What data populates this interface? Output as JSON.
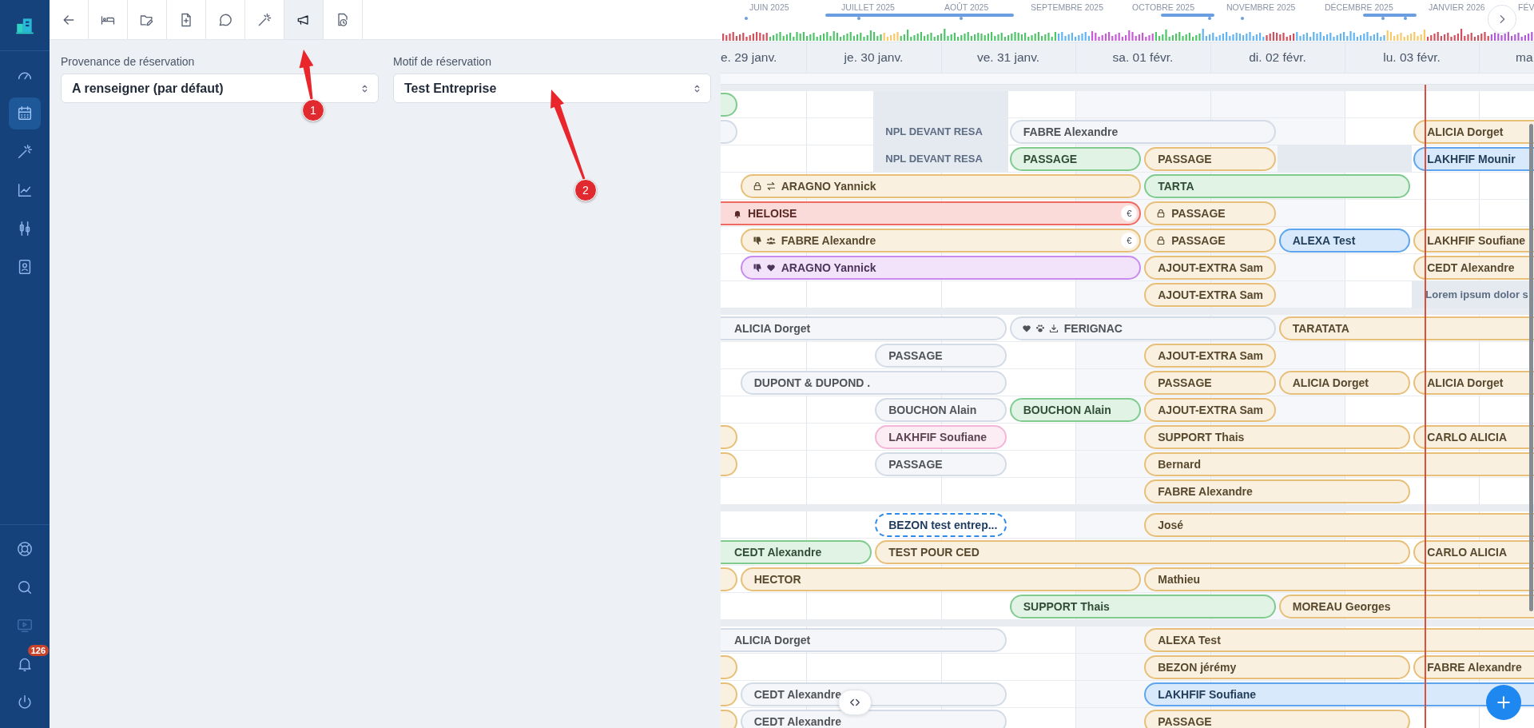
{
  "sidebar": {
    "nav": [
      {
        "kind": "gauge",
        "selected": false
      },
      {
        "kind": "calendar",
        "selected": true
      },
      {
        "kind": "wand",
        "selected": false
      },
      {
        "kind": "chart",
        "selected": false
      },
      {
        "kind": "candles",
        "selected": false
      },
      {
        "kind": "contact",
        "selected": false
      }
    ],
    "bottom": [
      {
        "kind": "lifebuoy",
        "disabled": false
      },
      {
        "kind": "search",
        "disabled": false
      },
      {
        "kind": "tv",
        "disabled": true
      },
      {
        "kind": "bell",
        "disabled": false,
        "badge": "126"
      },
      {
        "kind": "power",
        "disabled": false
      }
    ]
  },
  "toolbar": {
    "tabs": [
      {
        "kind": "back",
        "selected": false
      },
      {
        "kind": "bed",
        "selected": false
      },
      {
        "kind": "folder",
        "selected": false
      },
      {
        "kind": "file-plus",
        "selected": false
      },
      {
        "kind": "chat",
        "selected": false
      },
      {
        "kind": "wand",
        "selected": false
      },
      {
        "kind": "megaphone",
        "selected": true
      },
      {
        "kind": "file-clock",
        "selected": false
      }
    ]
  },
  "panel": {
    "fields": [
      {
        "label": "Provenance de réservation",
        "value": "A renseigner (par défaut)"
      },
      {
        "label": "Motif de réservation",
        "value": "Test Entreprise"
      }
    ]
  },
  "annotations": [
    {
      "label": "1"
    },
    {
      "label": "2"
    }
  ],
  "calendar": {
    "months": [
      "JUIN 2025",
      "JUILLET 2025",
      "AOÛT 2025",
      "SEPTEMBRE 2025",
      "OCTOBRE 2025",
      "NOVEMBRE 2025",
      "DÉCEMBRE 2025",
      "JANVIER 2026",
      "FÉV"
    ],
    "days": [
      "e. 29 janv.",
      "je. 30 janv.",
      "ve. 31 janv.",
      "sa. 01 févr.",
      "di. 02 févr.",
      "lu. 03 févr.",
      "ma"
    ],
    "groups": [
      {
        "rows": [
          {
            "items": [
              {
                "kind": "booking",
                "color": "#7fcb8e"
              },
              {
                "kind": "blocked"
              }
            ]
          },
          {
            "items": [
              {
                "kind": "booking",
                "color": "#d3dbe6"
              },
              {
                "kind": "blocked",
                "label": "NPL DEVANT RESA"
              },
              {
                "kind": "booking",
                "color": "#d3dbe6",
                "label": "FABRE Alexandre"
              },
              {
                "kind": "booking",
                "color": "#e8bf78",
                "label": "ALICIA Dorget"
              }
            ]
          },
          {
            "items": [
              {
                "kind": "blocked",
                "label": "NPL DEVANT RESA"
              },
              {
                "kind": "booking",
                "color": "#7fcb8e",
                "label": "PASSAGE"
              },
              {
                "kind": "booking",
                "color": "#e8bf78",
                "label": "PASSAGE"
              },
              {
                "kind": "blocked"
              },
              {
                "kind": "booking",
                "color": "#5ea5ee",
                "label": "LAKHFIF Mounir"
              }
            ]
          },
          {
            "items": [
              {
                "kind": "booking",
                "color": "#e8bf78",
                "label": "ARAGNO Yannick",
                "icons": [
                  {
                    "kind": "lock"
                  },
                  {
                    "kind": "swap"
                  }
                ]
              },
              {
                "kind": "booking",
                "color": "#7fcb8e",
                "label": "TARTA"
              }
            ]
          },
          {
            "items": [
              {
                "kind": "booking",
                "color": "#ef6b62",
                "label": "HELOISE",
                "icons": [
                  {
                    "kind": "bell"
                  }
                ],
                "end_badge": "€"
              },
              {
                "kind": "booking",
                "color": "#e8bf78",
                "label": "PASSAGE",
                "icons": [
                  {
                    "kind": "lock"
                  }
                ]
              }
            ]
          },
          {
            "items": [
              {
                "kind": "booking",
                "color": "#e8bf78",
                "label": "FABRE Alexandre",
                "icons": [
                  {
                    "kind": "thumbs-down"
                  },
                  {
                    "kind": "people"
                  }
                ],
                "end_badge": "€"
              },
              {
                "kind": "booking",
                "color": "#e8bf78",
                "label": "PASSAGE",
                "icons": [
                  {
                    "kind": "lock"
                  }
                ]
              },
              {
                "kind": "booking",
                "color": "#5ea5ee",
                "label": "ALEXA Test"
              },
              {
                "kind": "booking",
                "color": "#e8bf78",
                "label": "LAKHFIF Soufiane"
              }
            ]
          },
          {
            "items": [
              {
                "kind": "booking",
                "color": "#c98af0",
                "label": "ARAGNO Yannick",
                "icons": [
                  {
                    "kind": "thumbs-down"
                  },
                  {
                    "kind": "heart"
                  }
                ]
              },
              {
                "kind": "booking",
                "color": "#e8bf78",
                "label": "AJOUT-EXTRA Sam"
              },
              {
                "kind": "booking",
                "color": "#e8bf78",
                "label": "CEDT Alexandre"
              }
            ]
          },
          {
            "items": [
              {
                "kind": "booking",
                "color": "#e8bf78",
                "label": "AJOUT-EXTRA Sam"
              },
              {
                "kind": "blocked",
                "label": "Lorem ipsum dolor s"
              }
            ]
          }
        ]
      },
      {
        "rows": [
          {
            "items": [
              {
                "kind": "booking",
                "color": "#d3dbe6",
                "label": "ALICIA Dorget"
              },
              {
                "kind": "booking",
                "color": "#d3dbe6",
                "label": "FERIGNAC",
                "icons": [
                  {
                    "kind": "heart"
                  },
                  {
                    "kind": "paw"
                  },
                  {
                    "kind": "download"
                  }
                ]
              },
              {
                "kind": "booking",
                "color": "#e8bf78",
                "label": "TARATATA"
              }
            ]
          },
          {
            "items": [
              {
                "kind": "booking",
                "color": "#d3dbe6",
                "label": "PASSAGE"
              },
              {
                "kind": "booking",
                "color": "#e8bf78",
                "label": "AJOUT-EXTRA Sam"
              }
            ]
          },
          {
            "items": [
              {
                "kind": "booking",
                "color": "#d3dbe6",
                "label": "DUPONT & DUPOND ."
              },
              {
                "kind": "booking",
                "color": "#e8bf78",
                "label": "PASSAGE"
              },
              {
                "kind": "booking",
                "color": "#e8bf78",
                "label": "ALICIA Dorget"
              },
              {
                "kind": "booking",
                "color": "#e8bf78",
                "label": "ALICIA Dorget"
              }
            ]
          },
          {
            "items": [
              {
                "kind": "booking",
                "color": "#d3dbe6",
                "label": "BOUCHON Alain"
              },
              {
                "kind": "booking",
                "color": "#7fcb8e",
                "label": "BOUCHON Alain"
              },
              {
                "kind": "booking",
                "color": "#e8bf78",
                "label": "AJOUT-EXTRA Sam"
              }
            ]
          },
          {
            "items": [
              {
                "kind": "booking",
                "color": "#e8bf78"
              },
              {
                "kind": "booking",
                "color": "#f3b6d6",
                "label": "LAKHFIF Soufiane"
              },
              {
                "kind": "booking",
                "color": "#e8bf78",
                "label": "SUPPORT Thais"
              },
              {
                "kind": "booking",
                "color": "#e8bf78",
                "label": "CARLO ALICIA"
              }
            ]
          },
          {
            "items": [
              {
                "kind": "booking",
                "color": "#e8bf78"
              },
              {
                "kind": "booking",
                "color": "#d3dbe6",
                "label": "PASSAGE"
              },
              {
                "kind": "booking",
                "color": "#e8bf78",
                "label": "Bernard"
              }
            ]
          },
          {
            "items": [
              {
                "kind": "booking",
                "color": "#e8bf78",
                "label": "FABRE Alexandre"
              }
            ]
          }
        ]
      },
      {
        "rows": [
          {
            "items": [
              {
                "kind": "option",
                "color": "#2f8ae8",
                "label": "BEZON test entrep..."
              },
              {
                "kind": "booking",
                "color": "#e8bf78",
                "label": "José"
              }
            ]
          },
          {
            "items": [
              {
                "kind": "booking",
                "color": "#7fcb8e",
                "label": "CEDT Alexandre"
              },
              {
                "kind": "booking",
                "color": "#e8bf78",
                "label": "TEST POUR CED"
              },
              {
                "kind": "booking",
                "color": "#e8bf78",
                "label": "CARLO ALICIA"
              }
            ]
          },
          {
            "items": [
              {
                "kind": "booking",
                "color": "#e8bf78"
              },
              {
                "kind": "booking",
                "color": "#e8bf78",
                "label": "HECTOR"
              },
              {
                "kind": "booking",
                "color": "#e8bf78",
                "label": "Mathieu"
              }
            ]
          },
          {
            "items": [
              {
                "kind": "booking",
                "color": "#7fcb8e",
                "label": "SUPPORT Thais"
              },
              {
                "kind": "booking",
                "color": "#e8bf78",
                "label": "MOREAU Georges"
              }
            ]
          }
        ]
      },
      {
        "rows": [
          {
            "items": [
              {
                "kind": "booking",
                "color": "#d3dbe6",
                "label": "ALICIA Dorget"
              },
              {
                "kind": "booking",
                "color": "#e8bf78",
                "label": "ALEXA Test"
              }
            ]
          },
          {
            "items": [
              {
                "kind": "booking",
                "color": "#e8bf78"
              },
              {
                "kind": "booking",
                "color": "#e8bf78",
                "label": "BEZON jérémy"
              },
              {
                "kind": "booking",
                "color": "#e8bf78",
                "label": "FABRE Alexandre"
              }
            ]
          },
          {
            "items": [
              {
                "kind": "booking",
                "color": "#e8bf78"
              },
              {
                "kind": "booking",
                "color": "#d3dbe6",
                "label": "CEDT Alexandre"
              },
              {
                "kind": "booking",
                "color": "#5ea5ee",
                "label": "LAKHFIF Soufiane"
              }
            ]
          },
          {
            "items": [
              {
                "kind": "booking",
                "color": "#e8bf78"
              },
              {
                "kind": "booking",
                "color": "#d3dbe6",
                "label": "CEDT Alexandre"
              },
              {
                "kind": "booking",
                "color": "#e8bf78",
                "label": "PASSAGE"
              }
            ]
          }
        ]
      }
    ]
  }
}
